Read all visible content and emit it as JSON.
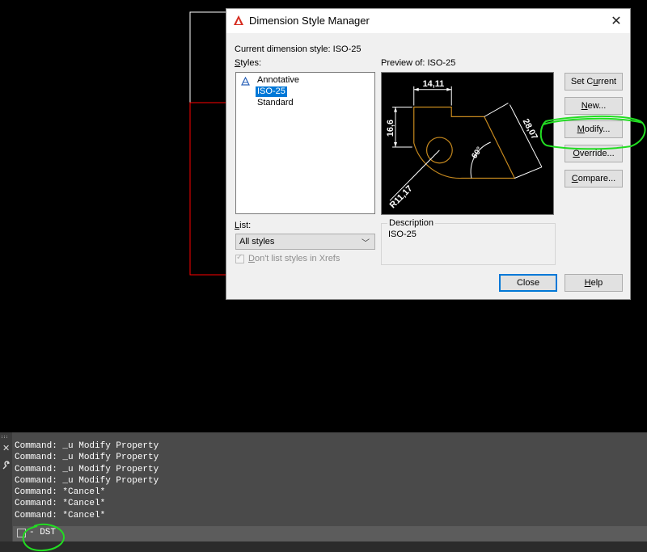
{
  "dialog": {
    "title": "Dimension Style Manager",
    "current_style_label": "Current dimension style: ISO-25",
    "styles_label": "Styles:",
    "styles": [
      "Annotative",
      "ISO-25",
      "Standard"
    ],
    "selected_style": "ISO-25",
    "preview_label": "Preview of: ISO-25",
    "preview_dims": {
      "top": "14,11",
      "left": "16,6",
      "diag": "28,07",
      "angle": "60°",
      "radius": "R11,17"
    },
    "buttons": {
      "set_current": "Set Current",
      "new": "New...",
      "modify": "Modify...",
      "override": "Override...",
      "compare": "Compare...",
      "close": "Close",
      "help": "Help"
    },
    "list_label": "List:",
    "list_value": "All styles",
    "xref_label": "Don't list styles in Xrefs",
    "description_legend": "Description",
    "description_text": "ISO-25"
  },
  "command": {
    "history": [
      "Command: _u Modify Property",
      "Command: _u Modify Property",
      "Command: _u Modify Property",
      "Command: _u Modify Property",
      "Command: *Cancel*",
      "Command: *Cancel*",
      "Command: *Cancel*"
    ],
    "input": "- DST"
  },
  "colors": {
    "background": "#000000",
    "selection": "#0078d7",
    "drawing_red": "#ff0000",
    "annotation_green": "#22dd22"
  },
  "icons": [
    "autocad-logo-icon",
    "close-icon",
    "annotative-icon",
    "chevron-down-icon",
    "wrench-icon",
    "command-prompt-icon"
  ]
}
